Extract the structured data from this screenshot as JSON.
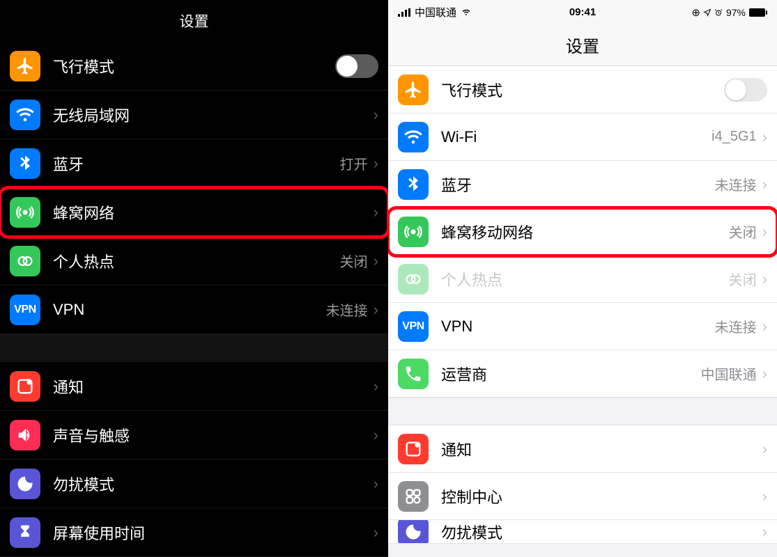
{
  "left": {
    "title": "设置",
    "airplane": "飞行模式",
    "wifi": "无线局域网",
    "bluetooth": "蓝牙",
    "bluetooth_value": "打开",
    "cellular": "蜂窝网络",
    "hotspot": "个人热点",
    "hotspot_value": "关闭",
    "vpn": "VPN",
    "vpn_value": "未连接",
    "notifications": "通知",
    "sound": "声音与触感",
    "dnd": "勿扰模式",
    "screentime": "屏幕使用时间"
  },
  "right": {
    "status_carrier": "中国联通",
    "status_time": "09:41",
    "status_battery_pct": "97%",
    "title": "设置",
    "airplane": "飞行模式",
    "wifi": "Wi-Fi",
    "wifi_value": "i4_5G1",
    "bluetooth": "蓝牙",
    "bluetooth_value": "未连接",
    "cellular": "蜂窝移动网络",
    "cellular_value": "关闭",
    "hotspot": "个人热点",
    "hotspot_value": "关闭",
    "vpn": "VPN",
    "vpn_value": "未连接",
    "carrier": "运营商",
    "carrier_value": "中国联通",
    "notifications": "通知",
    "control_center": "控制中心",
    "dnd_partial": "勿扰模式"
  }
}
